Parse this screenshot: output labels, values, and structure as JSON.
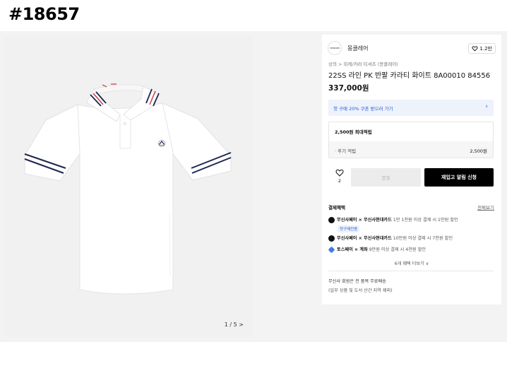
{
  "watermark": "#18657",
  "gallery": {
    "counter": "1 / 5 >"
  },
  "brand": {
    "logo_text": "MONCLER",
    "name": "몽클레어",
    "likes": "1.2만"
  },
  "breadcrumb": "상의 > 피케/카라 티셔츠 (몽클레어)",
  "product": {
    "title": "22SS 라인 PK 반팔 카라티 화이트 8A00010 84556",
    "price": "337,000원"
  },
  "coupon": {
    "text": "첫 구매 20% 쿠폰 받으러 가기",
    "arrow": "›"
  },
  "points": {
    "max": "2,500원 최대적립",
    "review_label": "· 후기 적립",
    "review_value": "2,500원"
  },
  "actions": {
    "like_count": "2",
    "buy_label": "품절",
    "restock_label": "재입고 알림 신청"
  },
  "benefits": {
    "title": "결제혜택",
    "more": "전체보기",
    "items": [
      {
        "partner": "무신사페이 × 무신사현대카드",
        "desc": "1만 1천원 이상 결제 시 1만원 할인",
        "icon": "musinsa-pay-icon"
      },
      {
        "partner": "무신사페이 × 무신사현대카드",
        "desc": "10만원 이상 결제 시 7천원 할인",
        "icon": "musinsa-pay-icon"
      },
      {
        "partner": "토스페이 × 계좌",
        "desc": "9만원 이상 결제 시 4천원 할인",
        "icon": "toss-pay-icon"
      }
    ],
    "tag": "첫구매전용",
    "expand": "6개 혜택 더보기 ∨"
  },
  "shipping": {
    "line1": "무신사 회원은 전 품목 무료배송",
    "line2": "(일부 상품 및 도서 산간 지역 제외)"
  },
  "colors": {
    "accent_blue": "#2a5bd7",
    "black_button": "#000000",
    "stripe_navy": "#1e2650",
    "stripe_red": "#c9333b"
  }
}
